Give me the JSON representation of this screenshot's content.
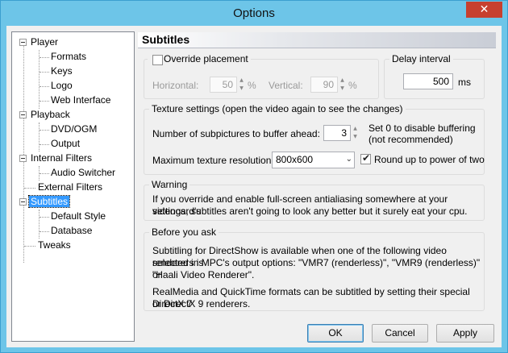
{
  "window": {
    "title": "Options",
    "close_symbol": "✕"
  },
  "tree": {
    "items": [
      {
        "label": "Player"
      },
      {
        "label": "Formats"
      },
      {
        "label": "Keys"
      },
      {
        "label": "Logo"
      },
      {
        "label": "Web Interface"
      },
      {
        "label": "Playback"
      },
      {
        "label": "DVD/OGM"
      },
      {
        "label": "Output"
      },
      {
        "label": "Internal Filters"
      },
      {
        "label": "Audio Switcher"
      },
      {
        "label": "External Filters"
      },
      {
        "label": "Subtitles"
      },
      {
        "label": "Default Style"
      },
      {
        "label": "Database"
      },
      {
        "label": "Tweaks"
      }
    ],
    "selected": "Subtitles"
  },
  "page": {
    "heading": "Subtitles",
    "placement": {
      "override_label": "Override placement",
      "override_checked": false,
      "horizontal_label": "Horizontal:",
      "horizontal_value": "50",
      "horizontal_unit": "%",
      "vertical_label": "Vertical:",
      "vertical_value": "90",
      "vertical_unit": "%"
    },
    "delay": {
      "legend": "Delay interval",
      "value": "500",
      "unit": "ms"
    },
    "texture": {
      "legend": "Texture settings (open the video again to see the changes)",
      "buffer_label": "Number of subpictures to buffer ahead:",
      "buffer_value": "3",
      "buffer_hint_1": "Set 0 to disable buffering",
      "buffer_hint_2": "(not recommended)",
      "max_res_label": "Maximum texture resolution:",
      "max_res_value": "800x600",
      "round_up_label": "Round up to power of two",
      "round_up_checked": true
    },
    "warning": {
      "legend": "Warning",
      "line_1": "If you override and enable full-screen antialiasing somewhere at your videocard's",
      "line_2": "settings, subtitles aren't going to look any better but it surely eat your cpu."
    },
    "before": {
      "legend": "Before you ask",
      "line_1": "Subtitling for DirectShow is available when one of the following video renderers is",
      "line_2": "selected in MPC's output options: \"VMR7 (renderless)\", \"VMR9 (renderless)\" or",
      "line_3": "\"Haali Video Renderer\".",
      "line_4": "RealMedia and QuickTime formats can be subtitled by setting their special DirectX 7",
      "line_5": "or DirectX 9 renderers."
    }
  },
  "buttons": {
    "ok": "OK",
    "cancel": "Cancel",
    "apply": "Apply"
  }
}
